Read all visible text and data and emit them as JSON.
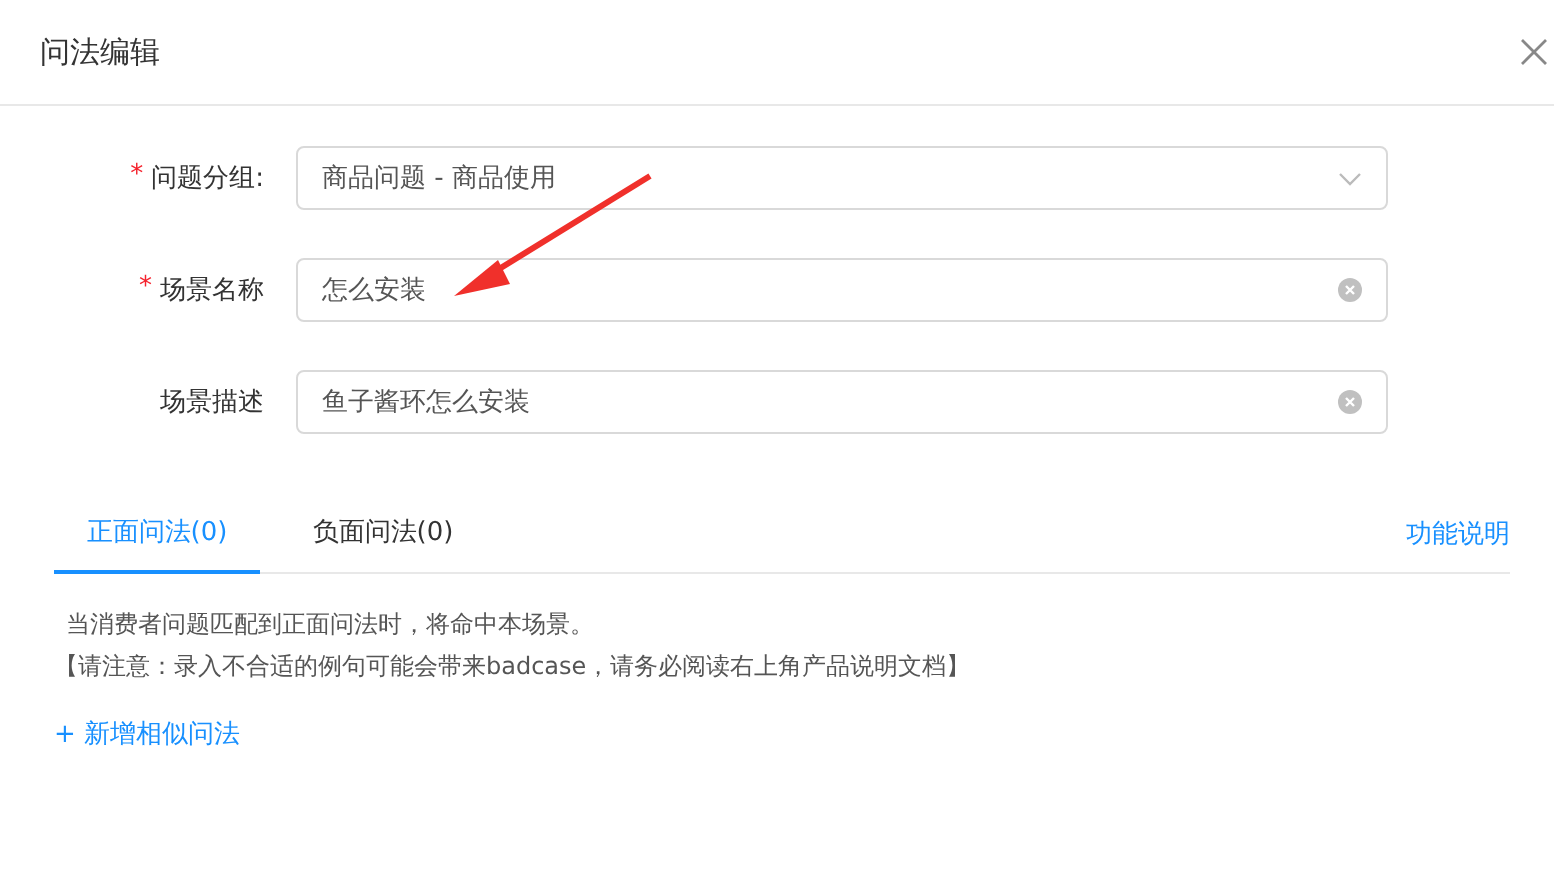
{
  "window": {
    "title": "问法编辑"
  },
  "fields": [
    {
      "label": "问题分组:",
      "required_mark": "*",
      "kind": "select",
      "value": "商品问题 - 商品使用"
    },
    {
      "label": "场景名称",
      "required_mark": "*",
      "kind": "input",
      "value": "怎么安装"
    },
    {
      "label": "场景描述",
      "kind": "input",
      "value": "鱼子酱环怎么安装"
    }
  ],
  "tabs": [
    {
      "label": "正面问法(0)",
      "selected": true
    },
    {
      "label": "负面问法(0)",
      "selected": false
    }
  ],
  "help_link": "功能说明",
  "notes": [
    "当消费者问题匹配到正面问法时，将命中本场景。",
    "【请注意：录入不合适的例句可能会带来badcase，请务必阅读右上角产品说明文档】"
  ],
  "add_link": "+ 新增相似问法"
}
